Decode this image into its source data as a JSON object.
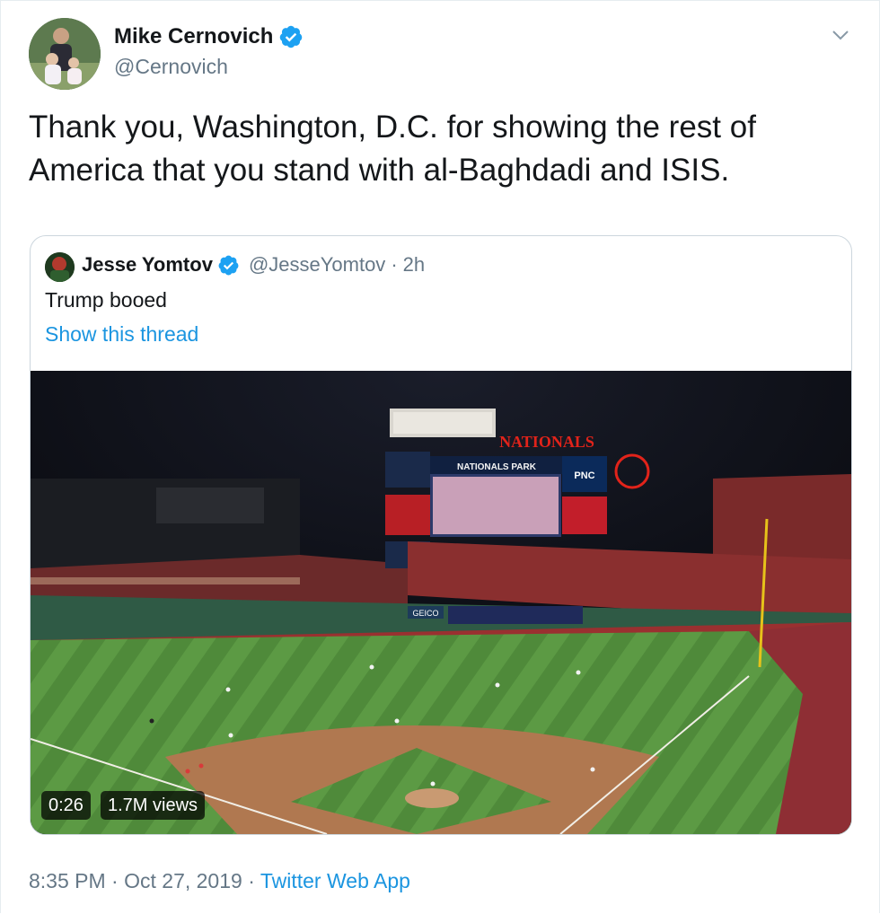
{
  "tweet": {
    "author_name": "Mike Cernovich",
    "author_handle": "@Cernovich",
    "text": "Thank you, Washington, D.C. for showing the rest of America that you stand with al-Baghdadi and ISIS.",
    "time": "8:35 PM",
    "date": "Oct 27, 2019",
    "separator": "·",
    "source": "Twitter Web App"
  },
  "quoted": {
    "author_name": "Jesse Yomtov",
    "author_handle": "@JesseYomtov",
    "separator": "·",
    "time_ago": "2h",
    "text": "Trump booed",
    "thread_link": "Show this thread",
    "video": {
      "duration": "0:26",
      "views": "1.7M views",
      "scoreboard_text": "NATIONALS PARK",
      "sign_nationals": "NATIONALS",
      "sign_pnc": "PNC",
      "sign_geico": "GEICO"
    }
  },
  "colors": {
    "text_primary": "#14171a",
    "text_secondary": "#657786",
    "link": "#1b95e0",
    "verified": "#1da1f2",
    "border": "#ccd6dd"
  },
  "icons": [
    "verified-badge-icon",
    "chevron-down-icon"
  ]
}
